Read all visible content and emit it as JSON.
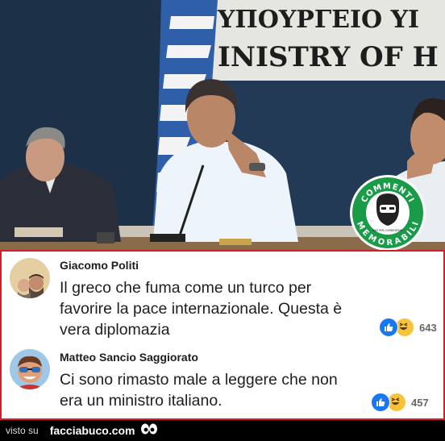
{
  "photo": {
    "sign_line1": "ΥΠΟΥΡΓΕΙΟ ΥΙ",
    "sign_line2": "INISTRY OF H"
  },
  "badge": {
    "top_text": "COMMENTI",
    "bottom_text": "MEMORABILI",
    "small_text": "NATI PER COMMENTARE"
  },
  "comments": [
    {
      "author": "Giacomo Politi",
      "text_lines": [
        "Il greco che fuma come un turco per",
        "favorire la pace internazionale. Questa è",
        "vera diplomazia"
      ],
      "reaction_count": "643"
    },
    {
      "author": "Matteo Sancio Saggiorato",
      "text_lines": [
        "Ci sono rimasto male a leggere che non",
        "era un ministro italiano."
      ],
      "reaction_count": "457"
    }
  ],
  "footer": {
    "visto_su": "visto su",
    "site": "facciabuco.com"
  },
  "colors": {
    "frame_border": "#d01f27",
    "badge_green": "#1a9b48",
    "like_blue": "#1877f2"
  }
}
